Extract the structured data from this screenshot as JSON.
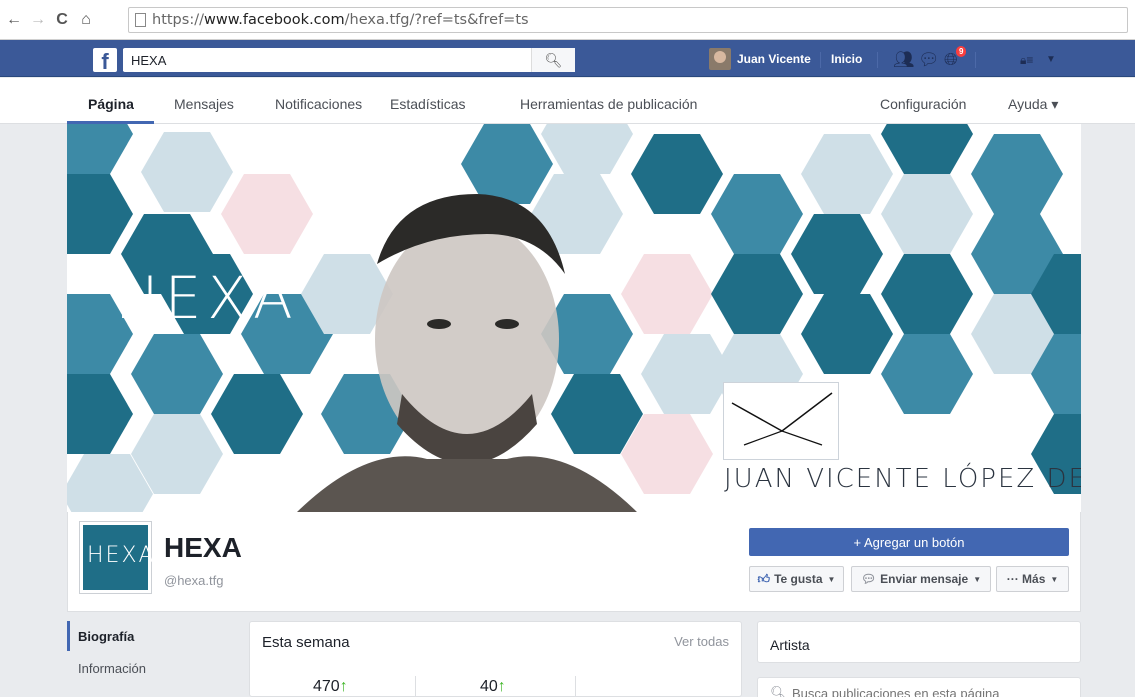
{
  "browser": {
    "url_prefix": "https://",
    "url_host": "www.facebook.com",
    "url_path": "/hexa.tfg/?ref=ts&fref=ts"
  },
  "fb_bar": {
    "logo": "f",
    "search_value": "HEXA",
    "user_name": "Juan Vicente",
    "home_label": "Inicio",
    "notification_count": "9"
  },
  "page_nav": {
    "tabs": [
      {
        "label": "Página"
      },
      {
        "label": "Mensajes"
      },
      {
        "label": "Notificaciones"
      },
      {
        "label": "Estadísticas"
      },
      {
        "label": "Herramientas de publicación"
      },
      {
        "label": "Configuración"
      },
      {
        "label": "Ayuda ▾"
      }
    ]
  },
  "cover": {
    "logo_text": "HEXA",
    "owner_name": "JUAN VICENTE LÓPEZ DELICADO"
  },
  "profile": {
    "avatar_text": "HEXA",
    "name": "HEXA",
    "handle": "@hexa.tfg",
    "add_button": "+ Agregar un botón",
    "like_button": "Te gusta",
    "message_button": "Enviar mensaje",
    "more_button": "··· Más"
  },
  "left_nav": {
    "items": [
      {
        "label": "Biografía"
      },
      {
        "label": "Información"
      }
    ]
  },
  "week": {
    "title": "Esta semana",
    "link": "Ver todas",
    "stats": [
      {
        "value": "470"
      },
      {
        "value": "40"
      }
    ]
  },
  "sidebar": {
    "category": "Artista",
    "search_placeholder": "Busca publicaciones en esta página"
  },
  "colors": {
    "fb_blue": "#3b5998",
    "button_blue": "#4267b2",
    "hex_dark": "#1f6e87",
    "hex_mid": "#3d8aa6",
    "hex_light": "#cfdfe7",
    "hex_pink": "#f6dfe3"
  }
}
